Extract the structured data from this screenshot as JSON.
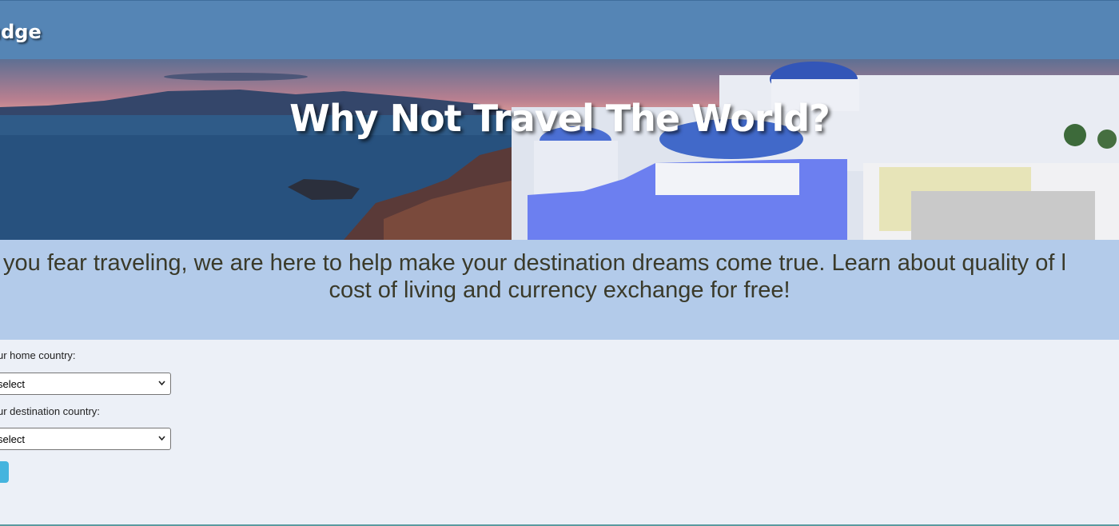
{
  "header": {
    "brand_text": "udge"
  },
  "hero": {
    "title": "Why Not Travel The World?"
  },
  "intro": {
    "line1": "you fear traveling, we are here to help make your destination dreams come true. Learn about quality of l",
    "line2": "cost of living and currency exchange for free!"
  },
  "form": {
    "home_label": "ur home country:",
    "home_selected": "select",
    "destination_label": "ur destination country:",
    "destination_selected": "select"
  },
  "icons": {
    "select_arrow": "chevron-down-icon"
  },
  "colors": {
    "header_bg": "#5585b5",
    "intro_bg": "#b3cbea",
    "page_bg": "#ecf0f7",
    "button_bg": "#45b4de"
  }
}
